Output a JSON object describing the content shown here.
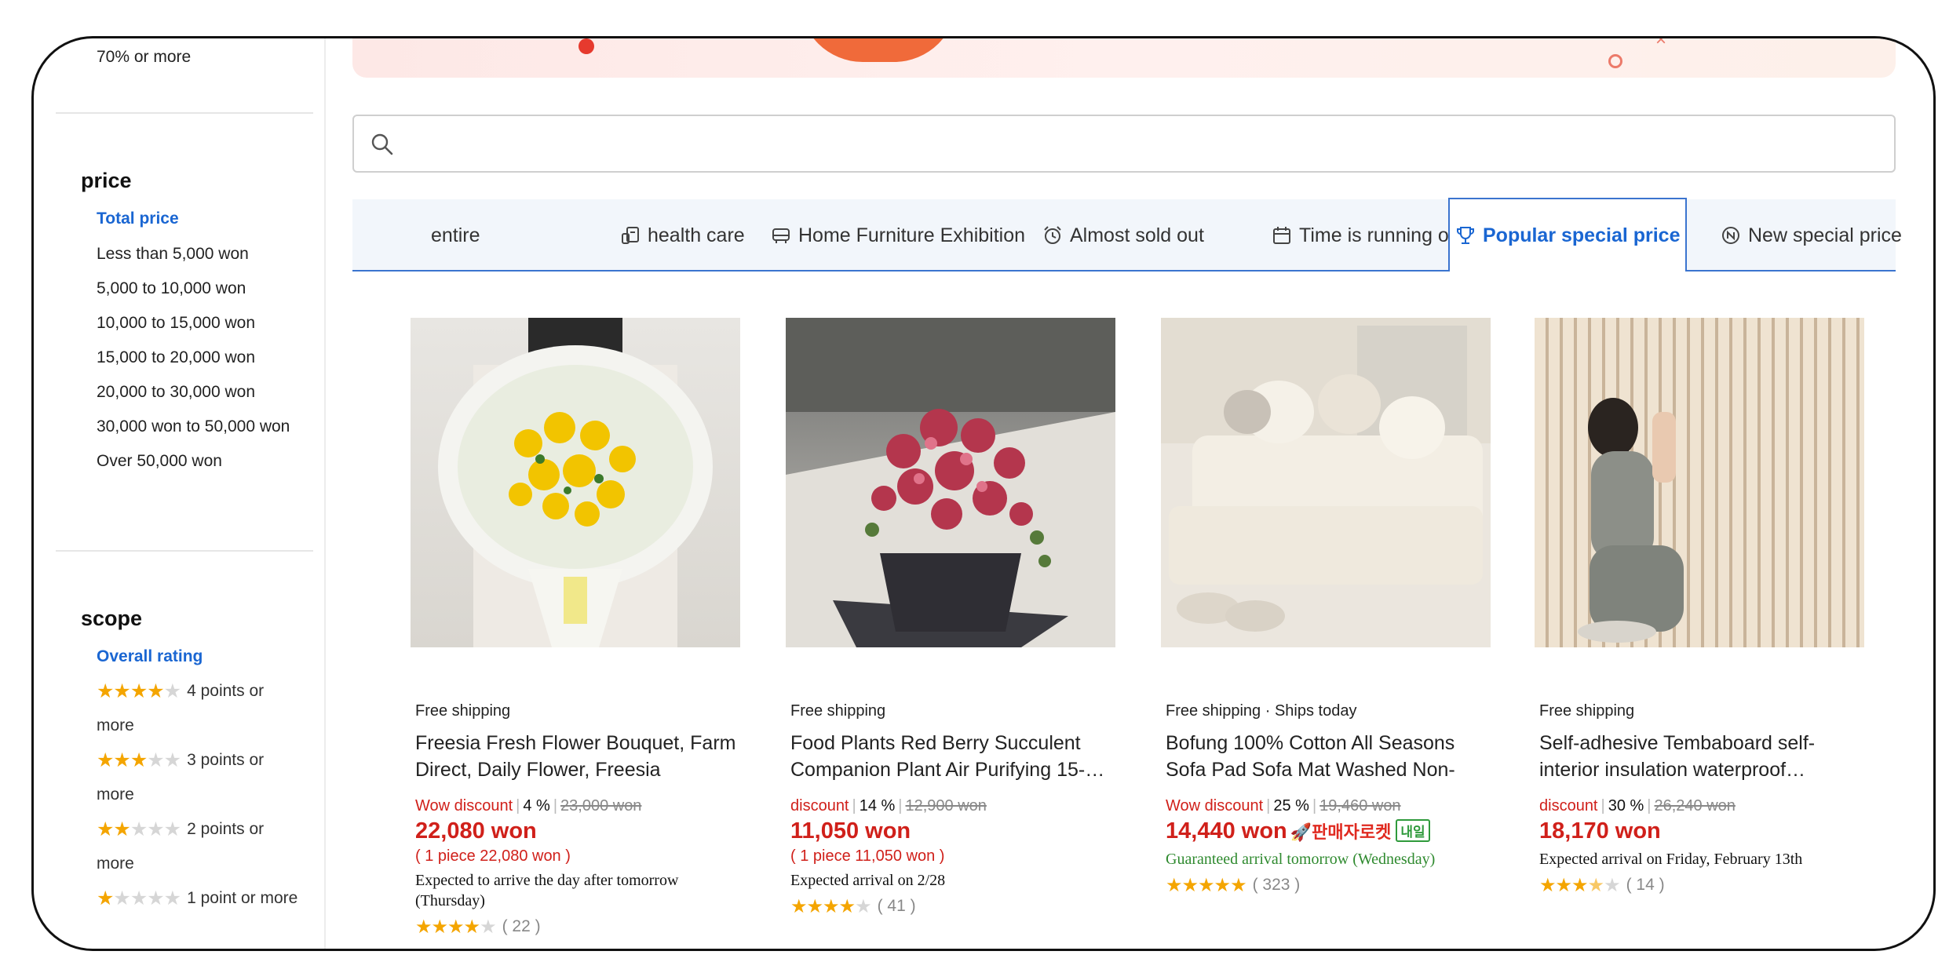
{
  "sidebar": {
    "discount_top": "70% or more",
    "price": {
      "title": "price",
      "selected": "Total price",
      "options": [
        "Less than 5,000 won",
        "5,000 to 10,000 won",
        "10,000 to 15,000 won",
        "15,000 to 20,000 won",
        "20,000 to 30,000 won",
        "30,000 won to 50,000 won",
        "Over 50,000 won"
      ]
    },
    "scope": {
      "title": "scope",
      "selected": "Overall rating",
      "options": [
        {
          "stars": 4,
          "label": "4 points or more"
        },
        {
          "stars": 3,
          "label": "3 points or more"
        },
        {
          "stars": 2,
          "label": "2 points or more"
        },
        {
          "stars": 1,
          "label": "1 point or more"
        }
      ]
    }
  },
  "search": {
    "placeholder": ""
  },
  "tabs": [
    {
      "label": "entire",
      "icon": "none"
    },
    {
      "label": "health care",
      "icon": "health-icon"
    },
    {
      "label": "Home Furniture Exhibition",
      "icon": "sofa-icon"
    },
    {
      "label": "Almost sold out",
      "icon": "alarm-clock-icon"
    },
    {
      "label": "Time is running out",
      "icon": "calendar-icon"
    },
    {
      "label": "Popular special price",
      "icon": "trophy-icon",
      "active": true
    },
    {
      "label": "New special price",
      "icon": "new-badge-icon"
    }
  ],
  "products": [
    {
      "shipping": "Free shipping",
      "name": "Freesia Fresh Flower Bouquet, Farm Direct, Daily Flower, Freesia Bouquet…",
      "discount_label": "Wow discount",
      "discount_pct": "4 %",
      "original_price": "23,000 won",
      "price": "22,080 won",
      "unit_price": "( 1 piece 22,080 won )",
      "arrival": "Expected to arrive the day after tomorrow (Thursday)",
      "rating": 4,
      "reviews": "( 22 )"
    },
    {
      "shipping": "Free shipping",
      "name": "Food Plants Red Berry Succulent Companion Plant Air Purifying 15-…",
      "discount_label": "discount",
      "discount_pct": "14 %",
      "original_price": "12,900 won",
      "price": "11,050 won",
      "unit_price": "( 1 piece 11,050 won )",
      "arrival": "Expected arrival on 2/28",
      "rating": 4,
      "reviews": "( 41 )"
    },
    {
      "shipping": "Free shipping · Ships today",
      "name": "Bofung 100% Cotton All Seasons Sofa Pad Sofa Mat Washed Non-Sli…",
      "discount_label": "Wow discount",
      "discount_pct": "25 %",
      "original_price": "19,460 won",
      "price": "14,440 won",
      "rocket_label": "판매자로켓",
      "rocket_tag": "내일",
      "arrival": "Guaranteed arrival tomorrow (Wednesday)",
      "rating": 5,
      "reviews": "( 323 )"
    },
    {
      "shipping": "Free shipping",
      "name": "Self-adhesive Tembaboard self-interior insulation waterproof…",
      "discount_label": "discount",
      "discount_pct": "30 %",
      "original_price": "26,240 won",
      "price": "18,170 won",
      "arrival": "Expected arrival on Friday, February 13th",
      "rating": 3.5,
      "reviews": "( 14 )"
    }
  ],
  "colors": {
    "accent": "#1a66d2",
    "sale_red": "#d0201a",
    "star": "#f4a500",
    "green": "#2f8a2f"
  }
}
